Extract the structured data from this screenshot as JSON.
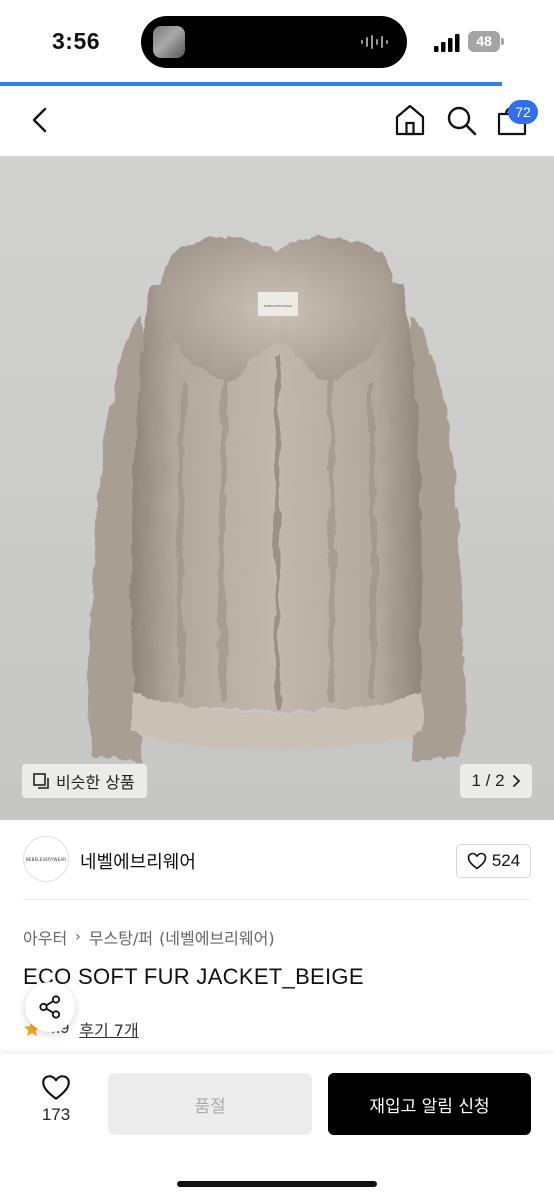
{
  "status_bar": {
    "time": "3:56",
    "battery": "48"
  },
  "page_progress": 0.906,
  "nav": {
    "back_icon": "chevron-left-icon",
    "home_icon": "home-icon",
    "search_icon": "search-icon",
    "cart_icon": "cart-icon",
    "cart_count": "72"
  },
  "gallery": {
    "similar_label": "비슷한 상품",
    "pager": "1 / 2",
    "label_tag": "NEBELEVERYWEAR"
  },
  "brand": {
    "logo_text": "NEBELEVERYWEAR",
    "name": "네벨에브리웨어",
    "likes": "524"
  },
  "breadcrumb": [
    "아우터",
    "무스탕/퍼",
    "(네벨에브리웨어)"
  ],
  "product": {
    "title": "ECO SOFT FUR JACKET_BEIGE",
    "rating": "4.9",
    "reviews": "후기 7개"
  },
  "bottom": {
    "wish_count": "173",
    "soldout_label": "품절",
    "restock_label": "재입고 알림 신청"
  },
  "colors": {
    "accent": "#2f80ed",
    "badge": "#2f6fed",
    "rating_star": "#f5a623",
    "primary_button": "#000000"
  }
}
